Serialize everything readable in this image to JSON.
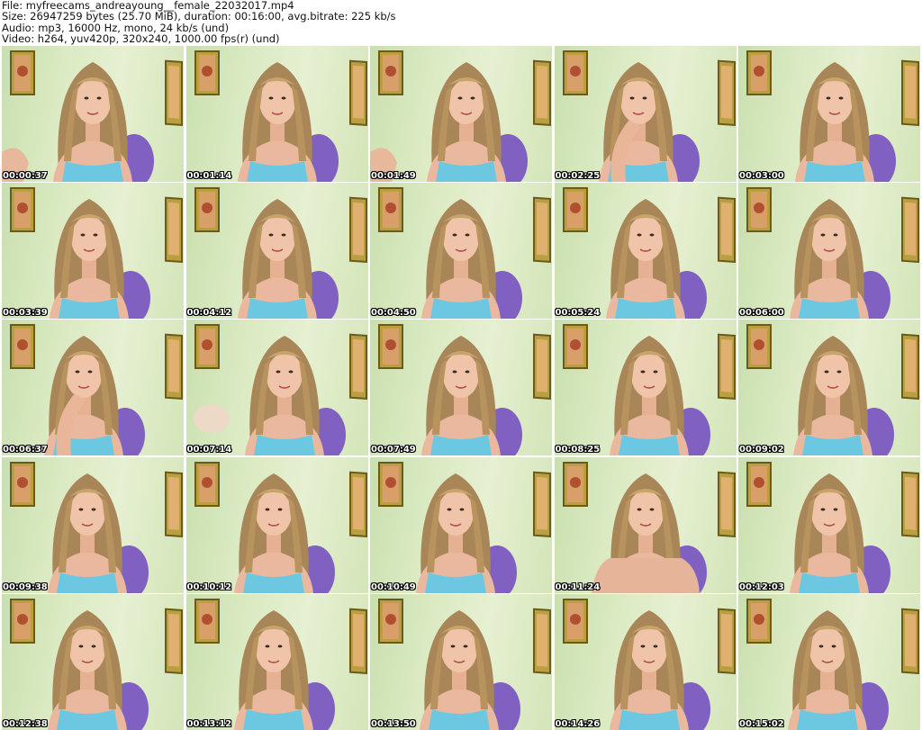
{
  "header": {
    "file_line": "File: myfreecams_andreayoung__female_22032017.mp4",
    "size_line": "Size: 26947259 bytes (25.70 MiB), duration: 00:16:00, avg.bitrate: 225 kb/s",
    "audio_line": "Audio: mp3, 16000 Hz, mono, 24 kb/s (und)",
    "video_line": "Video: h264, yuv420p, 320x240, 1000.00 fps(r) (und)"
  },
  "thumbnails": [
    {
      "timestamp": "00:00:37"
    },
    {
      "timestamp": "00:01:14"
    },
    {
      "timestamp": "00:01:49"
    },
    {
      "timestamp": "00:02:25"
    },
    {
      "timestamp": "00:03:00"
    },
    {
      "timestamp": "00:03:39"
    },
    {
      "timestamp": "00:04:12"
    },
    {
      "timestamp": "00:04:50"
    },
    {
      "timestamp": "00:05:24"
    },
    {
      "timestamp": "00:06:00"
    },
    {
      "timestamp": "00:06:37"
    },
    {
      "timestamp": "00:07:14"
    },
    {
      "timestamp": "00:07:49"
    },
    {
      "timestamp": "00:08:25"
    },
    {
      "timestamp": "00:09:02"
    },
    {
      "timestamp": "00:09:38"
    },
    {
      "timestamp": "00:10:12"
    },
    {
      "timestamp": "00:10:49"
    },
    {
      "timestamp": "00:11:24"
    },
    {
      "timestamp": "00:12:03"
    },
    {
      "timestamp": "00:12:38"
    },
    {
      "timestamp": "00:13:12"
    },
    {
      "timestamp": "00:13:50"
    },
    {
      "timestamp": "00:14:26"
    },
    {
      "timestamp": "00:15:02"
    }
  ]
}
